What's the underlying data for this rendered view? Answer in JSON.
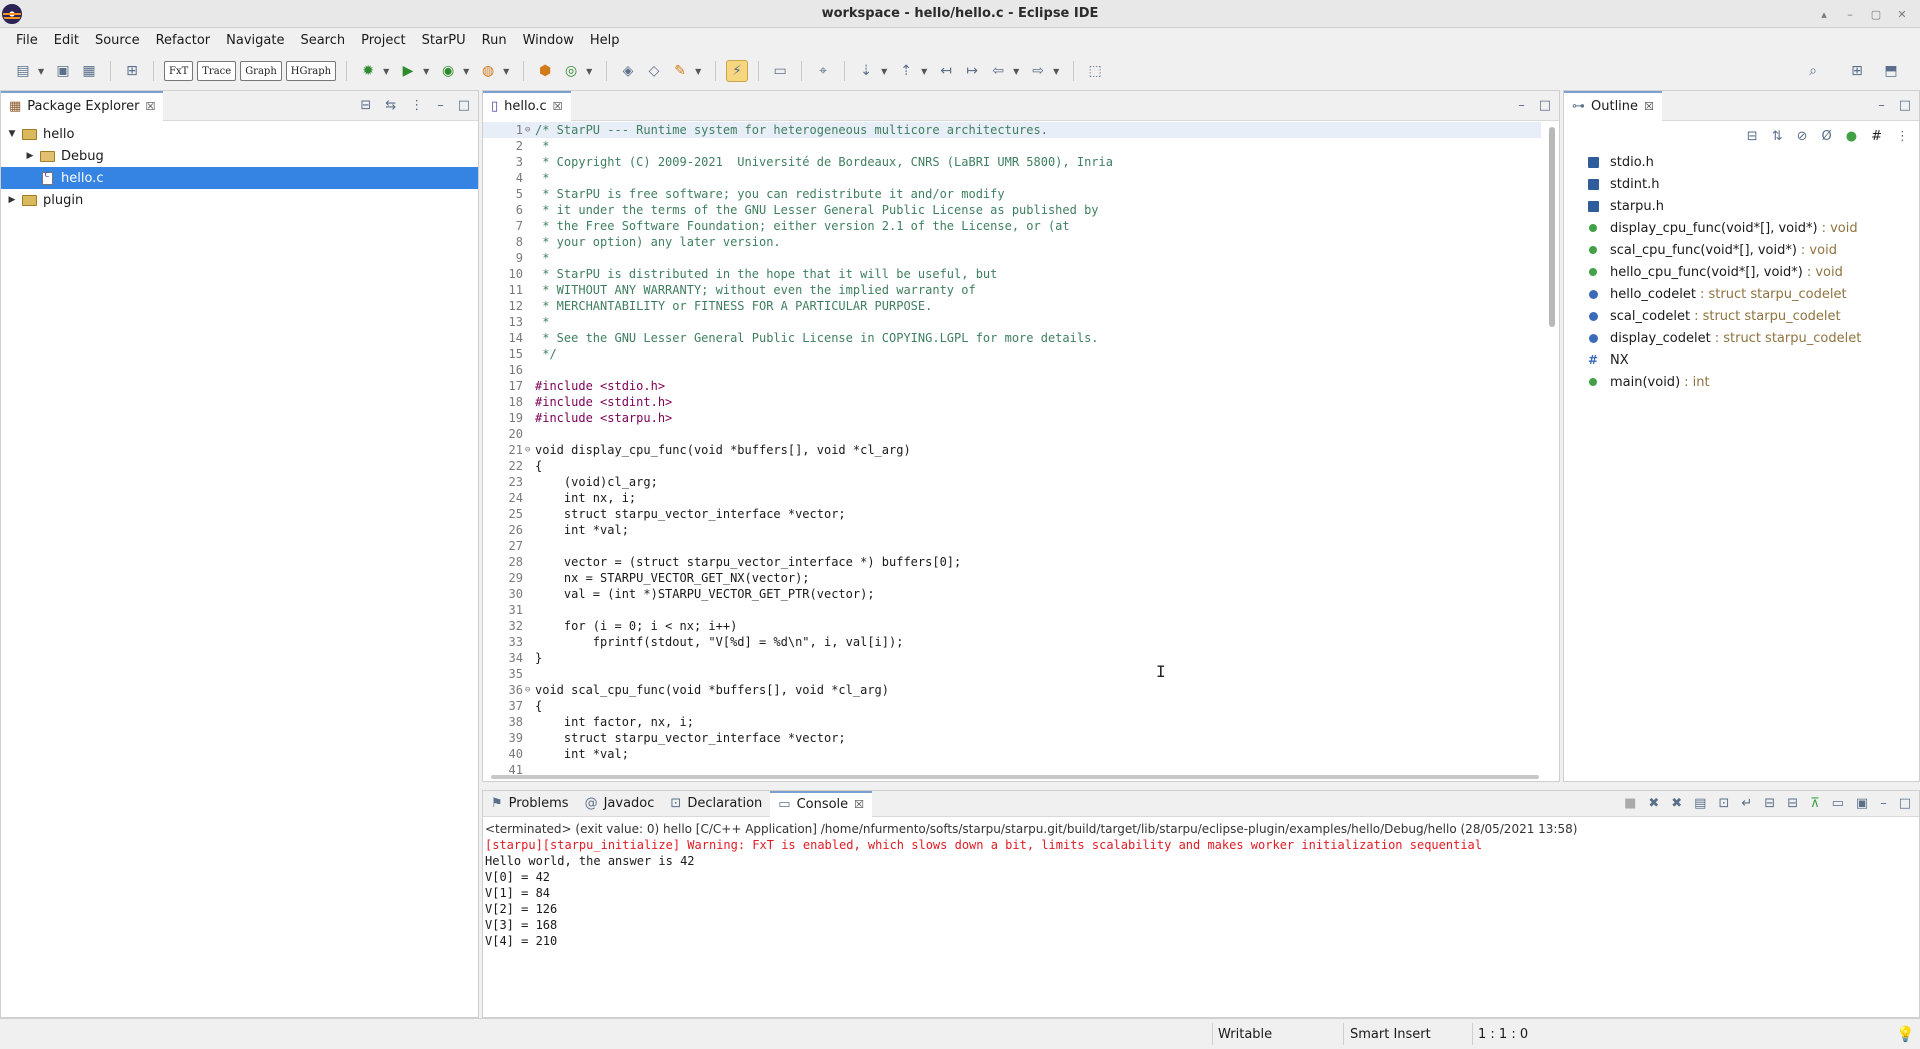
{
  "window": {
    "title": "workspace - hello/hello.c - Eclipse IDE"
  },
  "menubar": [
    "File",
    "Edit",
    "Source",
    "Refactor",
    "Navigate",
    "Search",
    "Project",
    "StarPU",
    "Run",
    "Window",
    "Help"
  ],
  "toolbar": {
    "text_buttons": [
      "FxT",
      "Trace",
      "Graph",
      "HGraph"
    ]
  },
  "package_explorer": {
    "title": "Package Explorer",
    "items": [
      {
        "label": "hello",
        "type": "project",
        "expanded": true,
        "indent": 0
      },
      {
        "label": "Debug",
        "type": "folder",
        "expanded": false,
        "indent": 1
      },
      {
        "label": "hello.c",
        "type": "file",
        "selected": true,
        "indent": 1
      },
      {
        "label": "plugin",
        "type": "project",
        "expanded": false,
        "indent": 0
      }
    ]
  },
  "editor": {
    "tab": "hello.c",
    "lines": [
      {
        "n": "1",
        "t": "/* StarPU --- Runtime system for heterogeneous multicore architectures.",
        "k": "comment",
        "fold": true
      },
      {
        "n": "2",
        "t": " *",
        "k": "comment"
      },
      {
        "n": "3",
        "t": " * Copyright (C) 2009-2021  Université de Bordeaux, CNRS (LaBRI UMR 5800), Inria",
        "k": "comment"
      },
      {
        "n": "4",
        "t": " *",
        "k": "comment"
      },
      {
        "n": "5",
        "t": " * StarPU is free software; you can redistribute it and/or modify",
        "k": "comment"
      },
      {
        "n": "6",
        "t": " * it under the terms of the GNU Lesser General Public License as published by",
        "k": "comment"
      },
      {
        "n": "7",
        "t": " * the Free Software Foundation; either version 2.1 of the License, or (at",
        "k": "comment"
      },
      {
        "n": "8",
        "t": " * your option) any later version.",
        "k": "comment"
      },
      {
        "n": "9",
        "t": " *",
        "k": "comment"
      },
      {
        "n": "10",
        "t": " * StarPU is distributed in the hope that it will be useful, but",
        "k": "comment"
      },
      {
        "n": "11",
        "t": " * WITHOUT ANY WARRANTY; without even the implied warranty of",
        "k": "comment"
      },
      {
        "n": "12",
        "t": " * MERCHANTABILITY or FITNESS FOR A PARTICULAR PURPOSE.",
        "k": "comment"
      },
      {
        "n": "13",
        "t": " *",
        "k": "comment"
      },
      {
        "n": "14",
        "t": " * See the GNU Lesser General Public License in COPYING.LGPL for more details.",
        "k": "comment"
      },
      {
        "n": "15",
        "t": " */",
        "k": "comment"
      },
      {
        "n": "16",
        "t": "",
        "k": "code"
      },
      {
        "n": "17",
        "t": "#include <stdio.h>",
        "k": "preproc"
      },
      {
        "n": "18",
        "t": "#include <stdint.h>",
        "k": "preproc"
      },
      {
        "n": "19",
        "t": "#include <starpu.h>",
        "k": "preproc"
      },
      {
        "n": "20",
        "t": "",
        "k": "code"
      },
      {
        "n": "21",
        "t": "void display_cpu_func(void *buffers[], void *cl_arg)",
        "k": "code",
        "fold": true
      },
      {
        "n": "22",
        "t": "{",
        "k": "code"
      },
      {
        "n": "23",
        "t": "    (void)cl_arg;",
        "k": "code"
      },
      {
        "n": "24",
        "t": "    int nx, i;",
        "k": "code"
      },
      {
        "n": "25",
        "t": "    struct starpu_vector_interface *vector;",
        "k": "code"
      },
      {
        "n": "26",
        "t": "    int *val;",
        "k": "code"
      },
      {
        "n": "27",
        "t": "",
        "k": "code"
      },
      {
        "n": "28",
        "t": "    vector = (struct starpu_vector_interface *) buffers[0];",
        "k": "code"
      },
      {
        "n": "29",
        "t": "    nx = STARPU_VECTOR_GET_NX(vector);",
        "k": "code"
      },
      {
        "n": "30",
        "t": "    val = (int *)STARPU_VECTOR_GET_PTR(vector);",
        "k": "code"
      },
      {
        "n": "31",
        "t": "",
        "k": "code"
      },
      {
        "n": "32",
        "t": "    for (i = 0; i < nx; i++)",
        "k": "code"
      },
      {
        "n": "33",
        "t": "        fprintf(stdout, \"V[%d] = %d\\n\", i, val[i]);",
        "k": "code"
      },
      {
        "n": "34",
        "t": "}",
        "k": "code"
      },
      {
        "n": "35",
        "t": "",
        "k": "code"
      },
      {
        "n": "36",
        "t": "void scal_cpu_func(void *buffers[], void *cl_arg)",
        "k": "code",
        "fold": true
      },
      {
        "n": "37",
        "t": "{",
        "k": "code"
      },
      {
        "n": "38",
        "t": "    int factor, nx, i;",
        "k": "code"
      },
      {
        "n": "39",
        "t": "    struct starpu_vector_interface *vector;",
        "k": "code"
      },
      {
        "n": "40",
        "t": "    int *val;",
        "k": "code"
      },
      {
        "n": "41",
        "t": "",
        "k": "code"
      }
    ]
  },
  "outline": {
    "title": "Outline",
    "items": [
      {
        "name": "stdio.h",
        "kind": "include",
        "type": ""
      },
      {
        "name": "stdint.h",
        "kind": "include",
        "type": ""
      },
      {
        "name": "starpu.h",
        "kind": "include",
        "type": ""
      },
      {
        "name": "display_cpu_func(void*[], void*)",
        "kind": "function",
        "type": ": void"
      },
      {
        "name": "scal_cpu_func(void*[], void*)",
        "kind": "function",
        "type": ": void"
      },
      {
        "name": "hello_cpu_func(void*[], void*)",
        "kind": "function",
        "type": ": void"
      },
      {
        "name": "hello_codelet",
        "kind": "variable",
        "type": ": struct starpu_codelet"
      },
      {
        "name": "scal_codelet",
        "kind": "variable",
        "type": ": struct starpu_codelet"
      },
      {
        "name": "display_codelet",
        "kind": "variable",
        "type": ": struct starpu_codelet"
      },
      {
        "name": "NX",
        "kind": "macro",
        "type": ""
      },
      {
        "name": "main(void)",
        "kind": "function",
        "type": ": int"
      }
    ]
  },
  "bottom_tabs": [
    {
      "label": "Problems",
      "icon": "problems-icon",
      "active": false
    },
    {
      "label": "Javadoc",
      "icon": "at-icon",
      "active": false
    },
    {
      "label": "Declaration",
      "icon": "declaration-icon",
      "active": false
    },
    {
      "label": "Console",
      "icon": "console-icon",
      "active": true
    }
  ],
  "console": {
    "header": "<terminated> (exit value: 0) hello [C/C++ Application] /home/nfurmento/softs/starpu/starpu.git/build/target/lib/starpu/eclipse-plugin/examples/hello/Debug/hello (28/05/2021 13:58)",
    "lines": [
      {
        "t": "[starpu][starpu_initialize] Warning: FxT is enabled, which slows down a bit, limits scalability and makes worker initialization sequential",
        "k": "err"
      },
      {
        "t": "Hello world, the answer is 42",
        "k": "out"
      },
      {
        "t": "V[0] = 42",
        "k": "out"
      },
      {
        "t": "V[1] = 84",
        "k": "out"
      },
      {
        "t": "V[2] = 126",
        "k": "out"
      },
      {
        "t": "V[3] = 168",
        "k": "out"
      },
      {
        "t": "V[4] = 210",
        "k": "out"
      }
    ]
  },
  "statusbar": {
    "writable": "Writable",
    "insert_mode": "Smart Insert",
    "position": "1 : 1 : 0"
  },
  "colors": {
    "accent": "#3584e4",
    "comment": "#3f7f5f",
    "keyword": "#7f0055",
    "error": "#e01b24"
  }
}
